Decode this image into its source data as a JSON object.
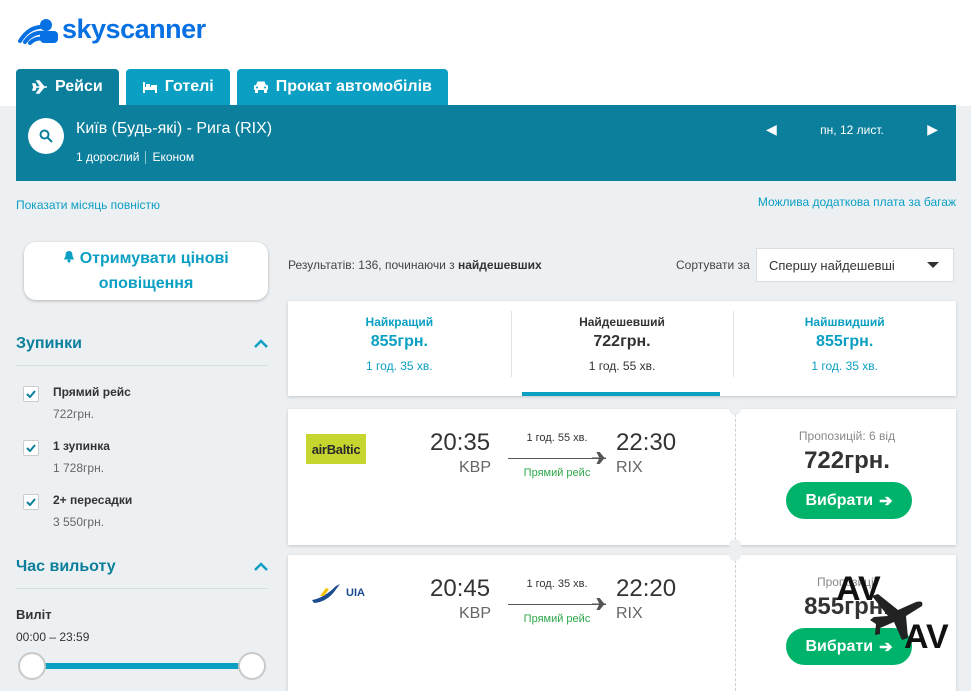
{
  "brand": {
    "name": "skyscanner",
    "color": "#0770e3"
  },
  "tabs": [
    {
      "label": "Рейси",
      "icon": "plane-icon",
      "active": true
    },
    {
      "label": "Готелі",
      "icon": "bed-icon",
      "active": false
    },
    {
      "label": "Прокат автомобілів",
      "icon": "car-icon",
      "active": false
    }
  ],
  "search": {
    "route": "Київ (Будь-які) - Рига (RIX)",
    "passengers": "1 дорослий",
    "cabin": "Економ",
    "date": "пн, 12 лист."
  },
  "links": {
    "show_month": "Показати місяць повністю",
    "baggage_note": "Можлива додаткова плата за багаж"
  },
  "sidebar": {
    "alert_button": "Отримувати цінові оповіщення",
    "stops": {
      "title": "Зупинки",
      "items": [
        {
          "label": "Прямий рейс",
          "price": "722грн.",
          "checked": true
        },
        {
          "label": "1 зупинка",
          "price": "1 728грн.",
          "checked": true
        },
        {
          "label": "2+ пересадки",
          "price": "3 550грн.",
          "checked": true
        }
      ]
    },
    "departure": {
      "title": "Час вильоту",
      "label": "Виліт",
      "range": "00:00 – 23:59"
    }
  },
  "results": {
    "count_prefix": "Результатів: 136, починаючи з ",
    "count_bold": "найдешевших",
    "sort_label": "Сортувати за",
    "sort_value": "Спершу найдешевші"
  },
  "summary": [
    {
      "title": "Найкращий",
      "price": "855грн.",
      "duration": "1 год. 35 хв.",
      "active": false
    },
    {
      "title": "Найдешевший",
      "price": "722грн.",
      "duration": "1 год. 55 хв.",
      "active": true
    },
    {
      "title": "Найшвидший",
      "price": "855грн.",
      "duration": "1 год. 35 хв.",
      "active": false
    }
  ],
  "flights": [
    {
      "airline": "airBaltic",
      "depart_time": "20:35",
      "depart_code": "KBP",
      "arrive_time": "22:30",
      "arrive_code": "RIX",
      "duration": "1 год. 55 хв.",
      "stops": "Прямий рейс",
      "offers": "Пропозицій: 6 від",
      "price": "722грн.",
      "button": "Вибрати"
    },
    {
      "airline": "UIA",
      "depart_time": "20:45",
      "depart_code": "KBP",
      "arrive_time": "22:20",
      "arrive_code": "RIX",
      "duration": "1 год. 35 хв.",
      "stops": "Прямий рейс",
      "offers": "Пропозиції",
      "price": "855грн.",
      "button": "Вибрати"
    }
  ],
  "watermark": {
    "line1": "AV",
    "line2": "AV"
  },
  "colors": {
    "teal_dark": "#0b7f9c",
    "teal": "#0a9fc3",
    "green": "#00b36b",
    "direct_green": "#2ea84a"
  }
}
